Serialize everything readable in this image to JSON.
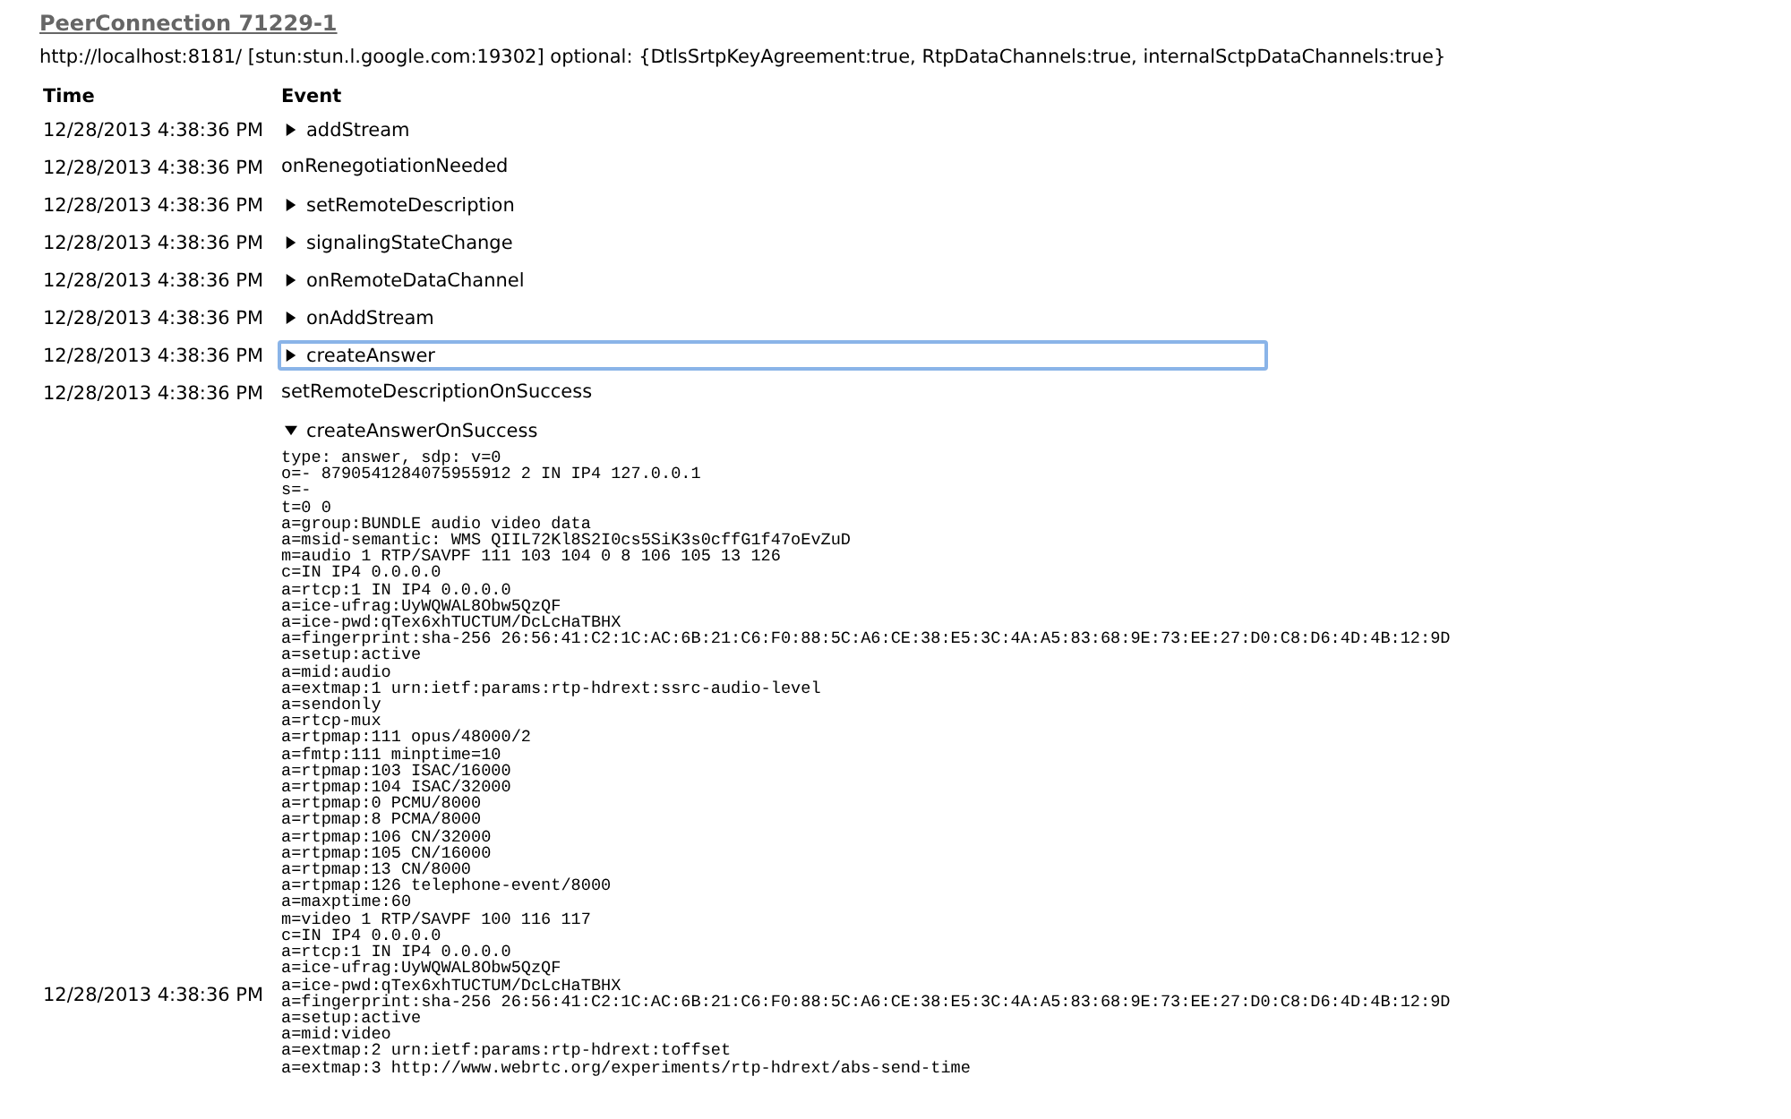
{
  "title": "PeerConnection 71229-1",
  "subtitle": "http://localhost:8181/ [stun:stun.l.google.com:19302] optional: {DtlsSrtpKeyAgreement:true, RtpDataChannels:true, internalSctpDataChannels:true}",
  "table": {
    "columns": [
      "Time",
      "Event"
    ],
    "rows": [
      {
        "time": "12/28/2013 4:38:36 PM",
        "event": "addStream",
        "kind": "details",
        "expanded": false,
        "selected": false
      },
      {
        "time": "12/28/2013 4:38:36 PM",
        "event": "onRenegotiationNeeded",
        "kind": "plain",
        "selected": false
      },
      {
        "time": "12/28/2013 4:38:36 PM",
        "event": "setRemoteDescription",
        "kind": "details",
        "expanded": false,
        "selected": false
      },
      {
        "time": "12/28/2013 4:38:36 PM",
        "event": "signalingStateChange",
        "kind": "details",
        "expanded": false,
        "selected": false
      },
      {
        "time": "12/28/2013 4:38:36 PM",
        "event": "onRemoteDataChannel",
        "kind": "details",
        "expanded": false,
        "selected": false
      },
      {
        "time": "12/28/2013 4:38:36 PM",
        "event": "onAddStream",
        "kind": "details",
        "expanded": false,
        "selected": false
      },
      {
        "time": "12/28/2013 4:38:36 PM",
        "event": "createAnswer",
        "kind": "details",
        "expanded": false,
        "selected": true
      },
      {
        "time": "12/28/2013 4:38:36 PM",
        "event": "setRemoteDescriptionOnSuccess",
        "kind": "plain",
        "selected": false
      },
      {
        "time": "12/28/2013 4:38:36 PM",
        "event": "createAnswerOnSuccess",
        "kind": "details",
        "expanded": true,
        "selected": false,
        "detail": "type: answer, sdp: v=0\no=- 8790541284075955912 2 IN IP4 127.0.0.1\ns=-\nt=0 0\na=group:BUNDLE audio video data\na=msid-semantic: WMS QIIL72Kl8S2I0cs5SiK3s0cffG1f47oEvZuD\nm=audio 1 RTP/SAVPF 111 103 104 0 8 106 105 13 126\nc=IN IP4 0.0.0.0\na=rtcp:1 IN IP4 0.0.0.0\na=ice-ufrag:UyWQWAL8Obw5QzQF\na=ice-pwd:qTex6xhTUCTUM/DcLcHaTBHX\na=fingerprint:sha-256 26:56:41:C2:1C:AC:6B:21:C6:F0:88:5C:A6:CE:38:E5:3C:4A:A5:83:68:9E:73:EE:27:D0:C8:D6:4D:4B:12:9D\na=setup:active\na=mid:audio\na=extmap:1 urn:ietf:params:rtp-hdrext:ssrc-audio-level\na=sendonly\na=rtcp-mux\na=rtpmap:111 opus/48000/2\na=fmtp:111 minptime=10\na=rtpmap:103 ISAC/16000\na=rtpmap:104 ISAC/32000\na=rtpmap:0 PCMU/8000\na=rtpmap:8 PCMA/8000\na=rtpmap:106 CN/32000\na=rtpmap:105 CN/16000\na=rtpmap:13 CN/8000\na=rtpmap:126 telephone-event/8000\na=maxptime:60\nm=video 1 RTP/SAVPF 100 116 117\nc=IN IP4 0.0.0.0\na=rtcp:1 IN IP4 0.0.0.0\na=ice-ufrag:UyWQWAL8Obw5QzQF\na=ice-pwd:qTex6xhTUCTUM/DcLcHaTBHX\na=fingerprint:sha-256 26:56:41:C2:1C:AC:6B:21:C6:F0:88:5C:A6:CE:38:E5:3C:4A:A5:83:68:9E:73:EE:27:D0:C8:D6:4D:4B:12:9D\na=setup:active\na=mid:video\na=extmap:2 urn:ietf:params:rtp-hdrext:toffset\na=extmap:3 http://www.webrtc.org/experiments/rtp-hdrext/abs-send-time"
      }
    ]
  }
}
